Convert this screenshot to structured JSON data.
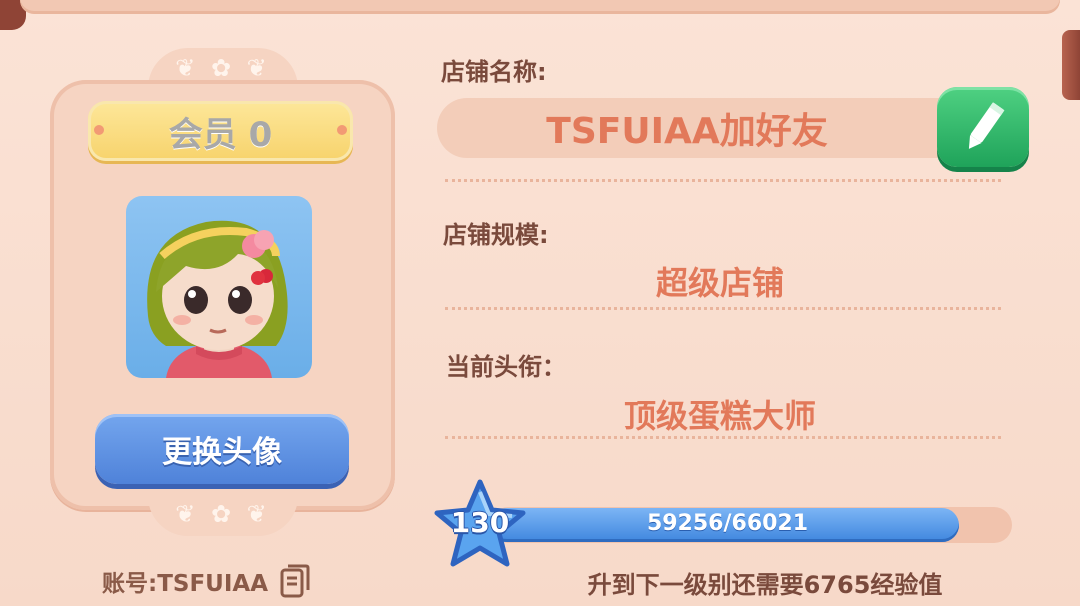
{
  "profile": {
    "vip_label": "会员 0",
    "change_avatar_label": "更换头像",
    "account_label": "账号:TSFUIAA"
  },
  "shop": {
    "name_label": "店铺名称:",
    "name_value": "TSFUIAA加好友",
    "scale_label": "店铺规模:",
    "scale_value": "超级店铺",
    "title_label": "当前头衔：",
    "title_value": "顶级蛋糕大师"
  },
  "level": {
    "level_number": "130",
    "xp_text": "59256/66021",
    "xp_current": 59256,
    "xp_max": 66021,
    "xp_hint": "升到下一级别还需要6765经验值"
  },
  "icons": {
    "edit": "pencil-icon",
    "copy": "copy-icon",
    "level": "star-icon"
  },
  "colors": {
    "accent_text": "#e2795a",
    "label_text": "#7a4a3c",
    "button_blue": "#4f82d9",
    "button_green": "#1fa35a",
    "vip_gold": "#f7d36c"
  }
}
